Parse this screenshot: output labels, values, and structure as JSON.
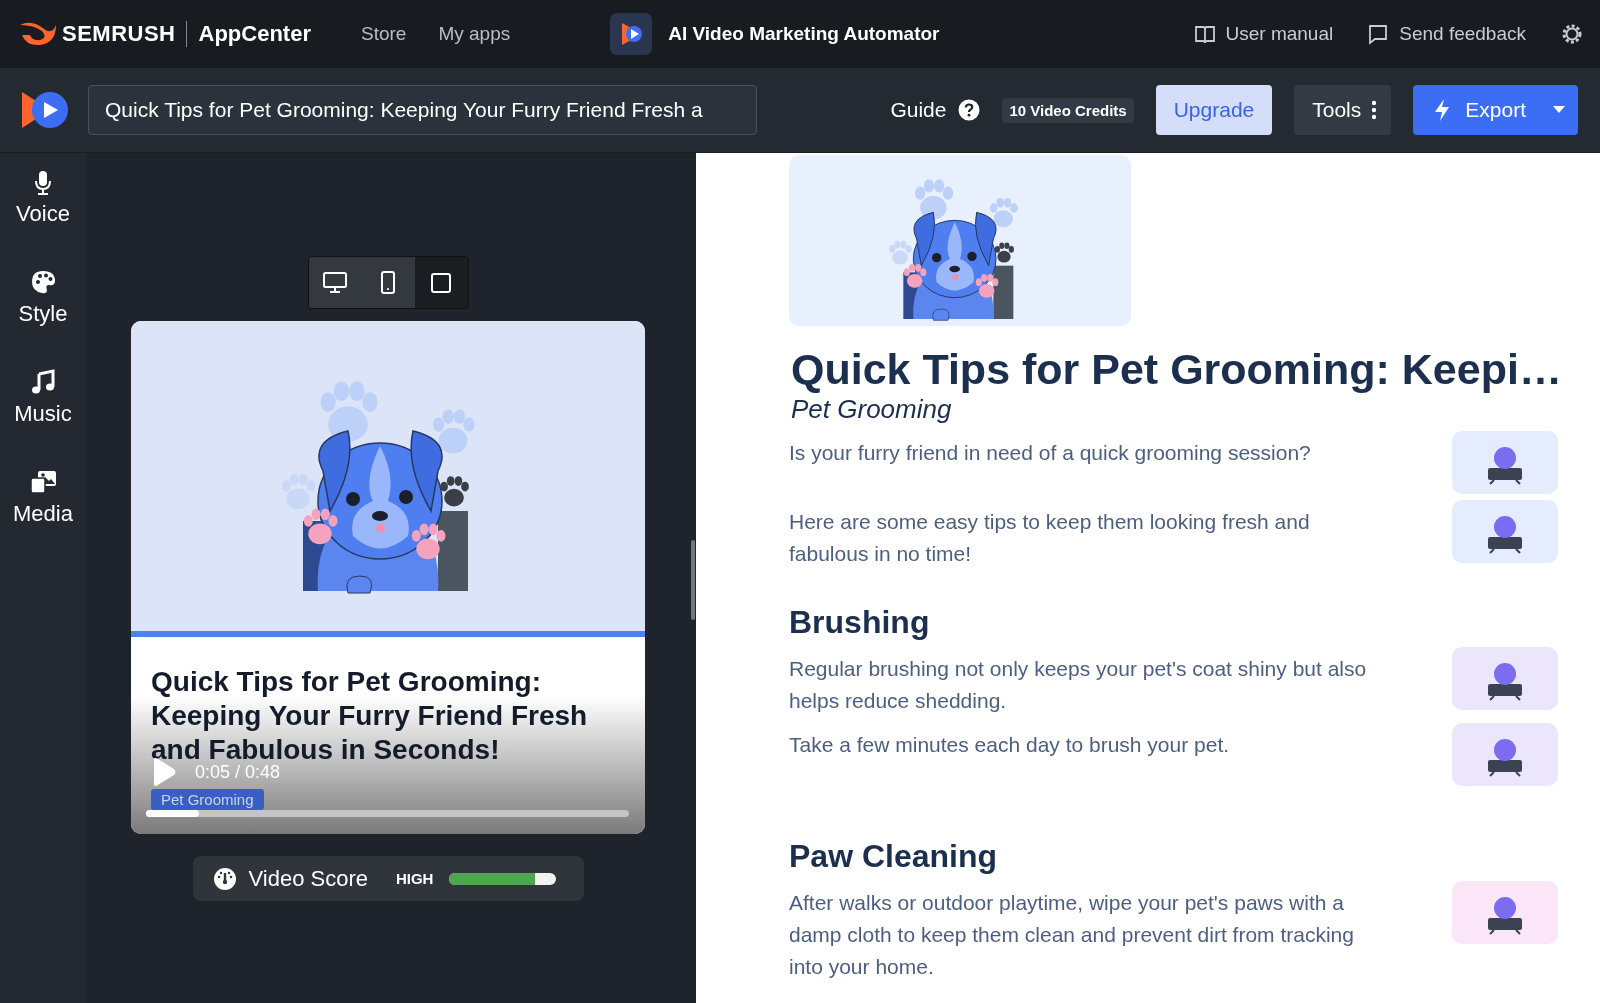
{
  "top_bar": {
    "brand": "SEMRUSH",
    "product": "AppCenter",
    "nav": [
      {
        "label": "Store"
      },
      {
        "label": "My apps"
      }
    ],
    "app_title": "AI Video Marketing Automator",
    "links": [
      {
        "label": "User manual",
        "kind": "manual"
      },
      {
        "label": "Send feedback",
        "kind": "feedback"
      }
    ]
  },
  "toolbar": {
    "video_title": "Quick Tips for Pet Grooming: Keeping Your Furry Friend Fresh a",
    "guide": "Guide",
    "credits": "10 Video Credits",
    "upgrade": "Upgrade",
    "tools": "Tools",
    "export": "Export"
  },
  "sidebar": {
    "items": [
      {
        "label": "Voice",
        "kind": "voice"
      },
      {
        "label": "Style",
        "kind": "style"
      },
      {
        "label": "Music",
        "kind": "music"
      },
      {
        "label": "Media",
        "kind": "media"
      }
    ]
  },
  "preview": {
    "devices": [
      {
        "kind": "desktop",
        "selected": false
      },
      {
        "kind": "phone",
        "selected": false
      },
      {
        "kind": "square",
        "selected": true
      }
    ],
    "video": {
      "title": "Quick Tips for Pet Grooming: Keeping Your Furry Friend Fresh and Fabulous in Seconds!",
      "time": "0:05 / 0:48",
      "tag": "Pet Grooming",
      "level": 0.11
    },
    "score": {
      "label": "Video Score",
      "rating": "HIGH",
      "level": 0.8
    }
  },
  "article": {
    "title": "Quick Tips for Pet Grooming: Keepi…",
    "subtitle": "Pet Grooming",
    "sections": [
      {
        "blocks": [
          {
            "text": "Is your furry friend in need of a quick grooming session?",
            "color": "#e4ecfd"
          },
          {
            "text": "Here are some easy tips to keep them looking fresh and fabulous in no time!",
            "color": "#e4ecfd"
          }
        ]
      },
      {
        "heading": "Brushing",
        "blocks": [
          {
            "text": "Regular brushing not only keeps your pet's coat shiny but also helps reduce shedding.",
            "color": "#ece6fd"
          },
          {
            "text": "Take a few minutes each day to brush your pet.",
            "color": "#ece6fd"
          }
        ]
      },
      {
        "heading": "Paw Cleaning",
        "blocks": [
          {
            "text": "After walks or outdoor playtime, wipe your pet's paws with a damp cloth to keep them clean and prevent dirt from tracking into your home.",
            "color": "#fbe6f8"
          }
        ]
      }
    ]
  }
}
